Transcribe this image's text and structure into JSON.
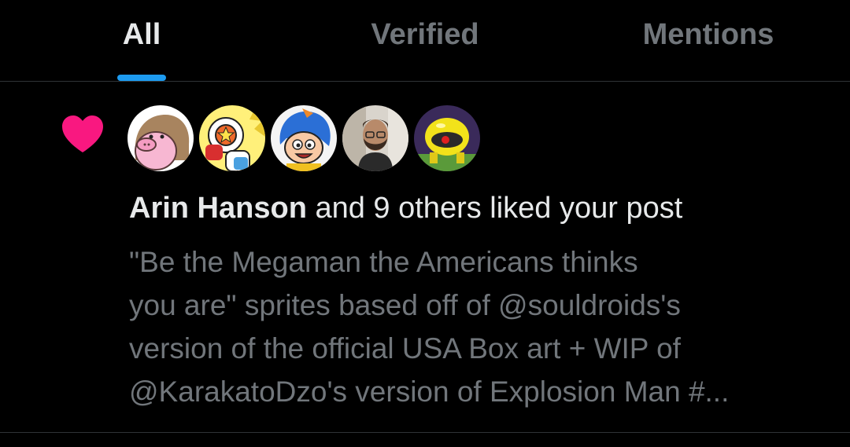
{
  "tabs": [
    {
      "label": "All",
      "active": true
    },
    {
      "label": "Verified",
      "active": false
    },
    {
      "label": "Mentions",
      "active": false
    }
  ],
  "notification": {
    "icon": "heart-icon",
    "icon_color": "#f91880",
    "avatars": [
      {
        "name": "avatar-pink-creature"
      },
      {
        "name": "avatar-yellow-cartoon"
      },
      {
        "name": "avatar-blue-hair-cartoon"
      },
      {
        "name": "avatar-bearded-man-photo"
      },
      {
        "name": "avatar-yellow-robot"
      }
    ],
    "actor_name": "Arin Hanson",
    "action_text": " and 9 others liked your post",
    "post_lines": [
      "\"Be the Megaman the Americans thinks",
      "you are\" sprites based off of @souldroids's",
      "version of the official USA Box art + WIP of",
      "@KarakatoDzo's version of Explosion Man #..."
    ]
  },
  "colors": {
    "background": "#000000",
    "text_primary": "#e7e9ea",
    "text_secondary": "#71767b",
    "accent": "#1d9bf0",
    "like": "#f91880",
    "divider": "#2f3336"
  }
}
